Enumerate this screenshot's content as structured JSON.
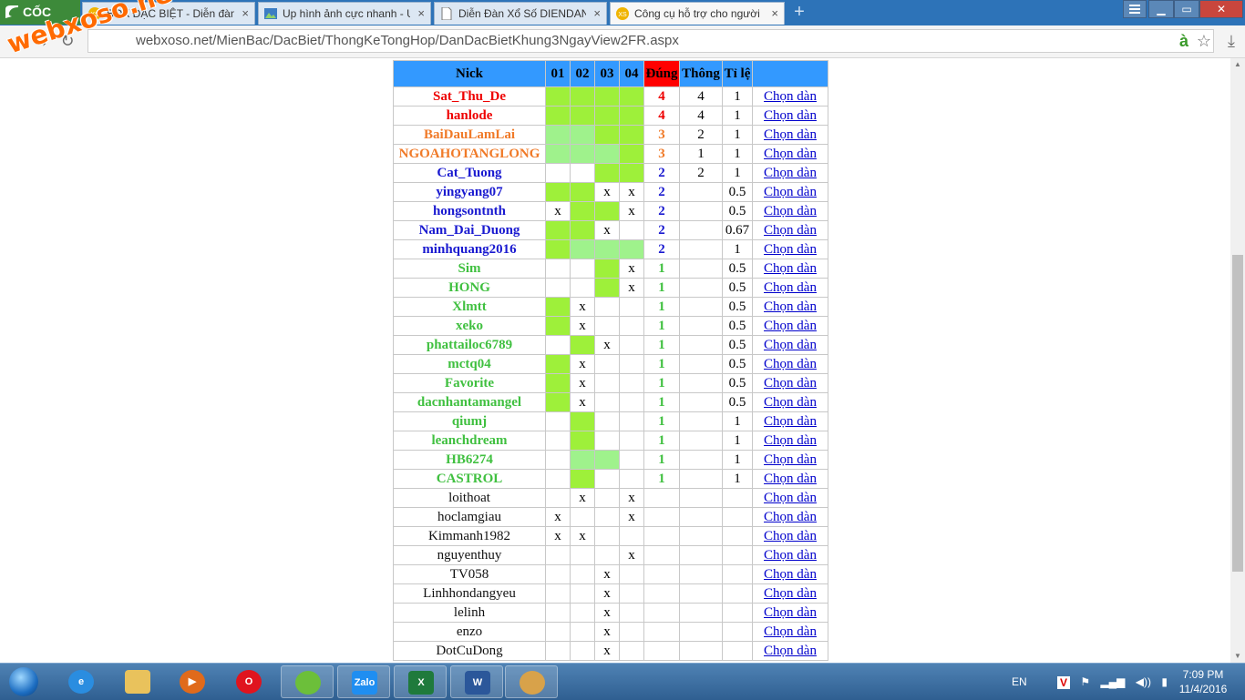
{
  "browser": {
    "brand": "CỐC CỐC",
    "tabs": [
      {
        "title": "BOX ĐẶC BIỆT - Diễn đàn",
        "icon": "xoso-icon",
        "active": false
      },
      {
        "title": "Up hình ảnh cực nhanh - U",
        "icon": "image-icon",
        "active": false
      },
      {
        "title": "Diễn Đàn Xổ Số DIENDAN",
        "icon": "page-icon",
        "active": false
      },
      {
        "title": "Công cụ hỗ trợ cho người",
        "icon": "xoso-icon",
        "active": true
      }
    ],
    "close_glyph": "×",
    "new_tab_glyph": "+",
    "window_controls": {
      "minimize": "▁",
      "maximize": "▭",
      "close": "✕"
    },
    "url": "webxoso.net/MienBac/DacBiet/ThongKeTongHop/DanDacBietKhung3NgayView2FR.aspx",
    "nav": {
      "back": "←",
      "forward": "→",
      "reload": "↻"
    },
    "translate_glyph": "à",
    "star_glyph": "☆",
    "download_glyph": "⤓"
  },
  "watermark": "webxoso.net",
  "table": {
    "headers": {
      "nick": "Nick",
      "c1": "01",
      "c2": "02",
      "c3": "03",
      "c4": "04",
      "dung": "Đúng",
      "thong": "Thông",
      "tile": "Tỉ lệ"
    },
    "link_label": "Chọn dàn",
    "rows": [
      {
        "nick": "Sat_Thu_De",
        "color": "red",
        "cells": [
          "g",
          "g",
          "g",
          "g"
        ],
        "dung": "4",
        "thong": "4",
        "tile": "1"
      },
      {
        "nick": "hanlode",
        "color": "red",
        "cells": [
          "g",
          "g",
          "g",
          "g"
        ],
        "dung": "4",
        "thong": "4",
        "tile": "1"
      },
      {
        "nick": "BaiDauLamLai",
        "color": "orange",
        "cells": [
          "lg",
          "lg",
          "g",
          "g"
        ],
        "dung": "3",
        "thong": "2",
        "tile": "1"
      },
      {
        "nick": "NGOAHOTANGLONG",
        "color": "orange",
        "cells": [
          "lg",
          "lg",
          "lg",
          "g"
        ],
        "dung": "3",
        "thong": "1",
        "tile": "1"
      },
      {
        "nick": "Cat_Tuong",
        "color": "blue",
        "cells": [
          "",
          "",
          "g",
          "g"
        ],
        "dung": "2",
        "thong": "2",
        "tile": "1"
      },
      {
        "nick": "yingyang07",
        "color": "blue",
        "cells": [
          "g",
          "g",
          "x",
          "x"
        ],
        "dung": "2",
        "thong": "",
        "tile": "0.5"
      },
      {
        "nick": "hongsontnth",
        "color": "blue",
        "cells": [
          "x",
          "g",
          "g",
          "x"
        ],
        "dung": "2",
        "thong": "",
        "tile": "0.5"
      },
      {
        "nick": "Nam_Dai_Duong",
        "color": "blue",
        "cells": [
          "g",
          "g",
          "x",
          ""
        ],
        "dung": "2",
        "thong": "",
        "tile": "0.67"
      },
      {
        "nick": "minhquang2016",
        "color": "blue",
        "cells": [
          "g",
          "lg",
          "lg",
          "lg"
        ],
        "dung": "2",
        "thong": "",
        "tile": "1"
      },
      {
        "nick": "Sim",
        "color": "green",
        "cells": [
          "",
          "",
          "g",
          "x"
        ],
        "dung": "1",
        "thong": "",
        "tile": "0.5"
      },
      {
        "nick": "HONG",
        "color": "green",
        "cells": [
          "",
          "",
          "g",
          "x"
        ],
        "dung": "1",
        "thong": "",
        "tile": "0.5"
      },
      {
        "nick": "Xlmtt",
        "color": "green",
        "cells": [
          "g",
          "x",
          "",
          ""
        ],
        "dung": "1",
        "thong": "",
        "tile": "0.5"
      },
      {
        "nick": "xeko",
        "color": "green",
        "cells": [
          "g",
          "x",
          "",
          ""
        ],
        "dung": "1",
        "thong": "",
        "tile": "0.5"
      },
      {
        "nick": "phattailoc6789",
        "color": "green",
        "cells": [
          "",
          "g",
          "x",
          ""
        ],
        "dung": "1",
        "thong": "",
        "tile": "0.5"
      },
      {
        "nick": "mctq04",
        "color": "green",
        "cells": [
          "g",
          "x",
          "",
          ""
        ],
        "dung": "1",
        "thong": "",
        "tile": "0.5"
      },
      {
        "nick": "Favorite",
        "color": "green",
        "cells": [
          "g",
          "x",
          "",
          ""
        ],
        "dung": "1",
        "thong": "",
        "tile": "0.5"
      },
      {
        "nick": "dacnhantamangel",
        "color": "green",
        "cells": [
          "g",
          "x",
          "",
          ""
        ],
        "dung": "1",
        "thong": "",
        "tile": "0.5"
      },
      {
        "nick": "qiumj",
        "color": "green",
        "cells": [
          "",
          "g",
          "",
          ""
        ],
        "dung": "1",
        "thong": "",
        "tile": "1"
      },
      {
        "nick": "leanchdream",
        "color": "green",
        "cells": [
          "",
          "g",
          "",
          ""
        ],
        "dung": "1",
        "thong": "",
        "tile": "1"
      },
      {
        "nick": "HB6274",
        "color": "green",
        "cells": [
          "",
          "lg",
          "lg",
          ""
        ],
        "dung": "1",
        "thong": "",
        "tile": "1"
      },
      {
        "nick": "CASTROL",
        "color": "green",
        "cells": [
          "",
          "g",
          "",
          ""
        ],
        "dung": "1",
        "thong": "",
        "tile": "1"
      },
      {
        "nick": "loithoat",
        "color": "plain",
        "cells": [
          "",
          "x",
          "",
          "x"
        ],
        "dung": "",
        "thong": "",
        "tile": ""
      },
      {
        "nick": "hoclamgiau",
        "color": "plain",
        "cells": [
          "x",
          "",
          "",
          "x"
        ],
        "dung": "",
        "thong": "",
        "tile": ""
      },
      {
        "nick": "Kimmanh1982",
        "color": "plain",
        "cells": [
          "x",
          "x",
          "",
          ""
        ],
        "dung": "",
        "thong": "",
        "tile": ""
      },
      {
        "nick": "nguyenthuy",
        "color": "plain",
        "cells": [
          "",
          "",
          "",
          "x"
        ],
        "dung": "",
        "thong": "",
        "tile": ""
      },
      {
        "nick": "TV058",
        "color": "plain",
        "cells": [
          "",
          "",
          "x",
          ""
        ],
        "dung": "",
        "thong": "",
        "tile": ""
      },
      {
        "nick": "Linhhondangyeu",
        "color": "plain",
        "cells": [
          "",
          "",
          "x",
          ""
        ],
        "dung": "",
        "thong": "",
        "tile": ""
      },
      {
        "nick": "lelinh",
        "color": "plain",
        "cells": [
          "",
          "",
          "x",
          ""
        ],
        "dung": "",
        "thong": "",
        "tile": ""
      },
      {
        "nick": "enzo",
        "color": "plain",
        "cells": [
          "",
          "",
          "x",
          ""
        ],
        "dung": "",
        "thong": "",
        "tile": ""
      },
      {
        "nick": "DotCuDong",
        "color": "plain",
        "cells": [
          "",
          "",
          "x",
          ""
        ],
        "dung": "",
        "thong": "",
        "tile": ""
      }
    ]
  },
  "taskbar": {
    "apps": [
      "ie-icon",
      "explorer-icon",
      "media-player-icon",
      "opera-icon",
      "coccoc-icon",
      "zalo-icon",
      "excel-icon",
      "word-icon",
      "paint-icon"
    ],
    "zalo_label": "Zalo",
    "excel_label": "X",
    "word_label": "W",
    "language": "EN",
    "time": "7:09 PM",
    "date": "11/4/2016"
  }
}
